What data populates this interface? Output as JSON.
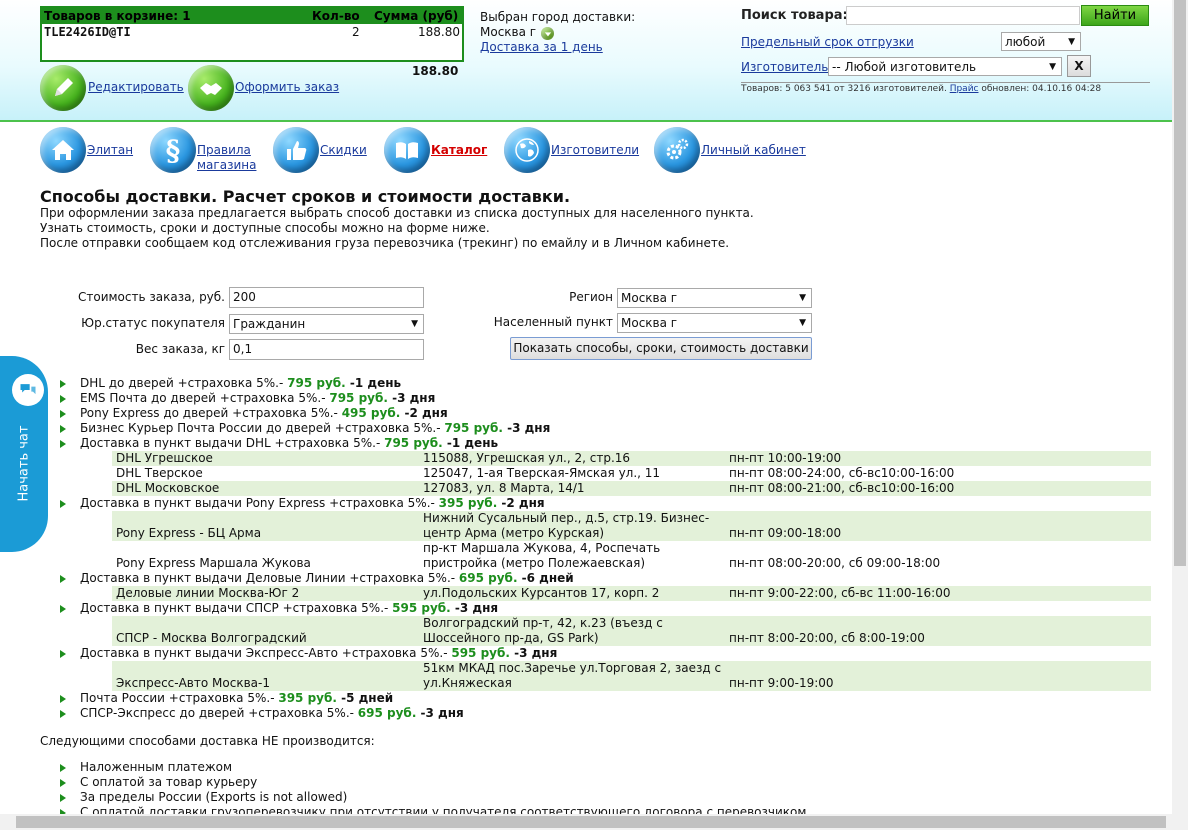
{
  "cart": {
    "head_items": "Товаров в корзине: 1",
    "head_qty": "Кол-во",
    "head_sum": "Сумма (руб)",
    "item_name": "TLE2426ID@TI",
    "item_qty": "2",
    "item_sum": "188.80",
    "total": "188.80",
    "edit_label": "Редактировать",
    "order_label": "Оформить заказ"
  },
  "delivery_city": {
    "title": "Выбран город доставки:",
    "city": "Москва г",
    "link": "Доставка за 1 день"
  },
  "search": {
    "label": "Поиск товара:",
    "value": "",
    "button": "Найти",
    "ship_term_label": "Предельный срок отгрузки",
    "ship_term_value": "любой",
    "maker_label": "Изготовитель",
    "maker_value": "-- Любой изготовитель",
    "clear_button": "X",
    "stats_prefix": "Товаров: 5 063 541 от 3216 изготовителей. ",
    "stats_link": "Прайс",
    "stats_suffix": " обновлен: 04.10.16 04:28"
  },
  "nav": [
    {
      "label": "Элитан",
      "icon": "home-icon"
    },
    {
      "label1": "Правила",
      "label2": "магазина",
      "icon": "paragraph-icon"
    },
    {
      "label": "Скидки",
      "icon": "thumbs-up-icon"
    },
    {
      "label": "Каталог",
      "icon": "book-icon",
      "active": true,
      "color": "#d40000"
    },
    {
      "label": "Изготовители",
      "icon": "globe-icon"
    },
    {
      "label": "Личный кабинет",
      "icon": "gears-icon"
    }
  ],
  "page": {
    "title": "Способы доставки. Расчет сроков и стоимости доставки.",
    "intro1": "При оформлении заказа предлагается выбрать способ доставки из списка доступных для населенного пункта.",
    "intro2": "Узнать стоимость, сроки и доступные способы можно на форме ниже.",
    "intro3": "После отправки сообщаем код отслеживания груза перевозчика (трекинг) по емайлу и в Личном кабинете."
  },
  "form": {
    "cost_label": "Стоимость заказа, руб.",
    "cost_value": "200",
    "status_label": "Юр.статус покупателя",
    "status_value": "Гражданин",
    "weight_label": "Вес заказа, кг",
    "weight_value": "0,1",
    "region_label": "Регион",
    "region_value": "Москва г",
    "locality_label": "Населенный пункт",
    "locality_value": "Москва г",
    "submit": "Показать способы, сроки, стоимость доставки"
  },
  "options": [
    {
      "name": "DHL до дверей +страховка 5%.- ",
      "price": "795 руб.",
      "days": " -1 день"
    },
    {
      "name": "EMS Почта до дверей +страховка 5%.- ",
      "price": "795 руб.",
      "days": " -3 дня"
    },
    {
      "name": "Pony Express до дверей +страховка 5%.- ",
      "price": "495 руб.",
      "days": " -2 дня"
    },
    {
      "name": "Бизнес Курьер Почта России до дверей +страховка 5%.- ",
      "price": "795 руб.",
      "days": " -3 дня"
    },
    {
      "name": "Доставка в пункт выдачи DHL +страховка 5%.- ",
      "price": "795 руб.",
      "days": " -1 день"
    },
    {
      "name": "Доставка в пункт выдачи Pony Express +страховка 5%.- ",
      "price": "395 руб.",
      "days": " -2 дня"
    },
    {
      "name": "Доставка в пункт выдачи Деловые Линии +страховка 5%.- ",
      "price": "695 руб.",
      "days": " -6 дней"
    },
    {
      "name": "Доставка в пункт выдачи СПСР +страховка 5%.- ",
      "price": "595 руб.",
      "days": " -3 дня"
    },
    {
      "name": "Доставка в пункт выдачи Экспресс-Авто +страховка 5%.- ",
      "price": "595 руб.",
      "days": " -3 дня"
    },
    {
      "name": "Почта России +страховка 5%.- ",
      "price": "395 руб.",
      "days": " -5 дней"
    },
    {
      "name": "СПСР-Экспресс до дверей +страховка 5%.- ",
      "price": "695 руб.",
      "days": " -3 дня"
    }
  ],
  "points": [
    {
      "name": "DHL Угрешское",
      "addr1": "115088, Угрешская ул., 2, стр.16",
      "addr2": "",
      "hours": "пн-пт 10:00-19:00"
    },
    {
      "name": "DHL Тверское",
      "addr1": "125047, 1-ая Тверская-Ямская ул., 11",
      "addr2": "",
      "hours": "пн-пт 08:00-24:00, сб-вс10:00-16:00"
    },
    {
      "name": "DHL Московское",
      "addr1": "127083, ул. 8 Марта, 14/1",
      "addr2": "",
      "hours": "пн-пт 08:00-21:00, сб-вс10:00-16:00"
    },
    {
      "name": "Pony Express - БЦ Арма",
      "addr1": "Нижний Сусальный пер., д.5, стр.19. Бизнес-",
      "addr2": "центр Арма (метро Курская)",
      "hours": "пн-пт 09:00-18:00"
    },
    {
      "name": "Pony Express Маршала Жукова",
      "addr1": "пр-кт Маршала Жукова, 4, Роспечать",
      "addr2": "пристройка (метро Полежаевская)",
      "hours": "пн-пт 08:00-20:00, сб 09:00-18:00"
    },
    {
      "name": "Деловые линии Москва-Юг 2",
      "addr1": "ул.Подольских Курсантов 17, корп. 2",
      "addr2": "",
      "hours": "пн-пт 9:00-22:00, сб-вс 11:00-16:00"
    },
    {
      "name": "СПСР - Москва Волгоградский",
      "addr1": "Волгоградский пр-т, 42, к.23 (въезд с",
      "addr2": "Шоссейного пр-да, GS Park)",
      "hours": "пн-пт 8:00-20:00, сб 8:00-19:00"
    },
    {
      "name": "Экспресс-Авто Москва-1",
      "addr1": "51км МКАД пос.Заречье ул.Торговая 2, заезд с",
      "addr2": "ул.Княжеская",
      "hours": "пн-пт 9:00-19:00"
    }
  ],
  "not_available": {
    "title": "Следующими способами доставка НЕ производится:",
    "items": [
      "Наложенным платежом",
      "С оплатой за товар курьеру",
      "За пределы России (Exports is not allowed)",
      "С оплатой доставки грузоперевозчику при отсутствии у получателя соответствующего договора с перевозчиком"
    ]
  },
  "chat": {
    "label": "Начать чат"
  }
}
